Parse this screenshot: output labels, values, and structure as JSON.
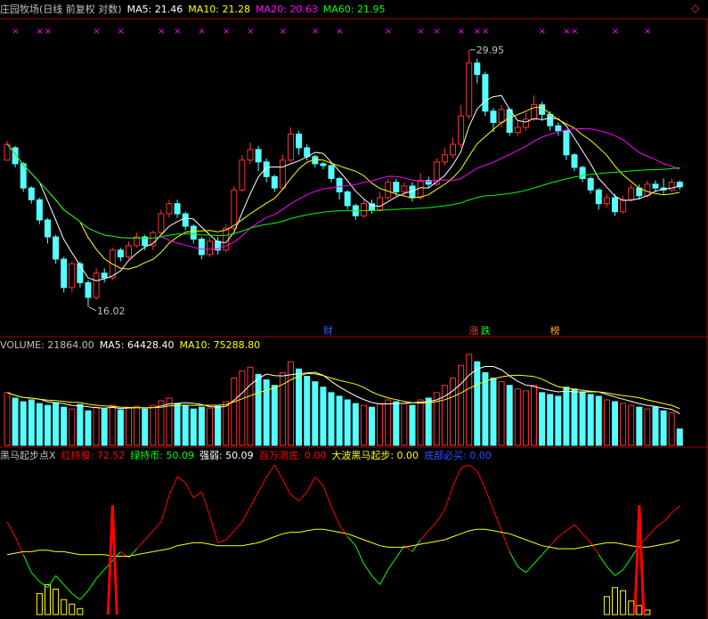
{
  "colors": {
    "bg": "#000000",
    "up": "#ff3232",
    "down": "#54ffff",
    "ma5": "#ffffff",
    "ma10": "#ffff00",
    "ma20": "#ff00ff",
    "ma60": "#00ff00",
    "grid": "#a00000",
    "marker": "#ff00ff",
    "label_gray": "#c0c0c0",
    "blue": "#0000ff",
    "green": "#00ff00",
    "red": "#ff0000",
    "yellow": "#ffff00"
  },
  "price_header": {
    "title": "庄园牧场(日线 前复权 对数)",
    "ma5": "MA5: 21.46",
    "ma10": "MA10: 21.28",
    "ma20": "MA20: 20.63",
    "ma60": "MA60: 21.95"
  },
  "volume_header": {
    "volume": "VOLUME: 21864.00",
    "ma5": "MA5: 64428.40",
    "ma10": "MA10: 75288.80"
  },
  "indicator_header": {
    "name": "黑马起步点X",
    "red_hold": "红持股: 72.52",
    "green_hold": "绿持币: 50.09",
    "strength": "强弱: 50.09",
    "million_bottom": "百万测底: 0.00",
    "wave_start": "大波黑马起步: 0.00",
    "bottom_buy": "底部必买: 0.00"
  },
  "annotations": {
    "high": "29.95",
    "low": "16.02",
    "tag_finance": "财",
    "tag_limit_up": "涨",
    "tag_limit_down": "跌",
    "tag_list": "榜"
  },
  "chart_data": [
    {
      "type": "candlestick",
      "title": "庄园牧场(日线 前复权 对数)",
      "scale": "log",
      "ylim": [
        15.5,
        31.0
      ],
      "annotated_high": 29.95,
      "annotated_low": 16.02,
      "series_ma": [
        {
          "name": "MA5",
          "last": 21.46
        },
        {
          "name": "MA10",
          "last": 21.28
        },
        {
          "name": "MA20",
          "last": 20.63
        },
        {
          "name": "MA60",
          "last": 21.95
        }
      ],
      "candles": [
        [
          22.9,
          23.8,
          23.6,
          24.0
        ],
        [
          23.6,
          22.7,
          22.5,
          23.7
        ],
        [
          22.7,
          21.4,
          21.2,
          22.8
        ],
        [
          21.4,
          20.8,
          20.6,
          21.5
        ],
        [
          20.8,
          19.8,
          19.6,
          20.9
        ],
        [
          19.8,
          19.0,
          18.7,
          19.9
        ],
        [
          19.0,
          18.0,
          17.8,
          19.1
        ],
        [
          18.0,
          16.8,
          16.6,
          18.1
        ],
        [
          16.8,
          17.8,
          16.6,
          17.9
        ],
        [
          17.8,
          17.0,
          16.8,
          17.9
        ],
        [
          17.0,
          16.4,
          16.02,
          17.1
        ],
        [
          16.4,
          17.4,
          16.3,
          17.6
        ],
        [
          17.4,
          17.2,
          17.0,
          17.6
        ],
        [
          17.2,
          18.4,
          17.1,
          18.5
        ],
        [
          18.4,
          18.1,
          17.9,
          18.5
        ],
        [
          18.1,
          18.6,
          18.0,
          18.8
        ],
        [
          18.6,
          19.0,
          18.5,
          19.2
        ],
        [
          19.0,
          18.6,
          18.4,
          19.1
        ],
        [
          18.6,
          19.2,
          18.4,
          19.3
        ],
        [
          19.2,
          20.1,
          19.1,
          20.3
        ],
        [
          20.1,
          20.6,
          19.9,
          20.8
        ],
        [
          20.6,
          20.1,
          19.9,
          20.8
        ],
        [
          20.1,
          19.5,
          19.3,
          20.2
        ],
        [
          19.5,
          18.9,
          18.7,
          19.6
        ],
        [
          18.9,
          18.2,
          18.0,
          19.0
        ],
        [
          18.2,
          18.8,
          18.1,
          19.0
        ],
        [
          18.8,
          18.4,
          18.2,
          19.0
        ],
        [
          18.4,
          19.4,
          18.3,
          19.6
        ],
        [
          19.4,
          21.3,
          19.3,
          21.5
        ],
        [
          21.3,
          22.9,
          21.2,
          23.2
        ],
        [
          22.9,
          23.5,
          22.7,
          23.9
        ],
        [
          23.5,
          22.8,
          22.3,
          23.7
        ],
        [
          22.8,
          22.0,
          21.7,
          23.0
        ],
        [
          22.0,
          21.4,
          21.2,
          22.1
        ],
        [
          21.4,
          22.9,
          21.3,
          23.2
        ],
        [
          22.9,
          24.4,
          22.8,
          24.8
        ],
        [
          24.4,
          23.6,
          23.2,
          24.6
        ],
        [
          23.6,
          23.1,
          22.9,
          23.8
        ],
        [
          23.1,
          22.7,
          22.5,
          23.2
        ],
        [
          22.7,
          22.6,
          22.4,
          22.8
        ],
        [
          22.6,
          21.9,
          21.7,
          22.7
        ],
        [
          21.9,
          21.2,
          20.8,
          22.0
        ],
        [
          21.2,
          20.5,
          20.3,
          21.3
        ],
        [
          20.5,
          20.0,
          19.8,
          20.6
        ],
        [
          20.0,
          20.6,
          19.9,
          20.8
        ],
        [
          20.6,
          20.3,
          20.1,
          20.8
        ],
        [
          20.3,
          20.9,
          20.2,
          21.2
        ],
        [
          20.9,
          21.7,
          20.8,
          21.9
        ],
        [
          21.7,
          21.2,
          21.0,
          21.9
        ],
        [
          21.2,
          21.5,
          21.0,
          21.7
        ],
        [
          21.5,
          20.9,
          20.7,
          21.7
        ],
        [
          20.9,
          21.8,
          20.8,
          22.2
        ],
        [
          21.8,
          21.6,
          21.4,
          22.0
        ],
        [
          21.6,
          22.8,
          21.5,
          23.0
        ],
        [
          22.8,
          23.2,
          22.6,
          23.6
        ],
        [
          23.2,
          23.8,
          23.0,
          24.2
        ],
        [
          23.8,
          25.5,
          23.6,
          26.2
        ],
        [
          25.5,
          29.0,
          25.3,
          29.95
        ],
        [
          29.0,
          28.2,
          27.6,
          29.3
        ],
        [
          28.2,
          25.8,
          25.5,
          28.4
        ],
        [
          25.8,
          25.1,
          24.5,
          26.0
        ],
        [
          25.1,
          25.9,
          24.8,
          26.2
        ],
        [
          25.9,
          24.5,
          24.3,
          26.0
        ],
        [
          24.5,
          24.8,
          24.3,
          25.2
        ],
        [
          24.8,
          25.3,
          24.6,
          25.7
        ],
        [
          25.3,
          26.2,
          25.2,
          26.8
        ],
        [
          26.2,
          25.6,
          25.2,
          26.4
        ],
        [
          25.6,
          24.9,
          24.6,
          25.8
        ],
        [
          24.9,
          24.6,
          24.3,
          25.1
        ],
        [
          24.6,
          23.2,
          22.9,
          24.7
        ],
        [
          23.2,
          22.5,
          22.3,
          23.3
        ],
        [
          22.5,
          21.9,
          21.7,
          22.6
        ],
        [
          21.9,
          21.3,
          21.1,
          22.0
        ],
        [
          21.3,
          20.6,
          20.3,
          21.4
        ],
        [
          20.6,
          20.9,
          20.4,
          21.1
        ],
        [
          20.9,
          20.2,
          20.0,
          21.1
        ],
        [
          20.2,
          20.8,
          20.1,
          21.0
        ],
        [
          20.8,
          21.4,
          20.7,
          21.6
        ],
        [
          21.4,
          21.0,
          20.8,
          21.6
        ],
        [
          21.0,
          21.6,
          20.9,
          21.8
        ],
        [
          21.6,
          21.4,
          21.2,
          21.8
        ],
        [
          21.4,
          21.3,
          21.1,
          21.9
        ],
        [
          21.3,
          21.7,
          21.2,
          21.9
        ],
        [
          21.7,
          21.46,
          21.3,
          21.8
        ]
      ]
    },
    {
      "type": "bar",
      "title": "VOLUME",
      "last": 21864.0,
      "ma5_last": 64428.4,
      "ma10_last": 75288.8,
      "values": [
        58,
        52,
        48,
        50,
        46,
        44,
        47,
        42,
        40,
        45,
        38,
        42,
        40,
        44,
        39,
        41,
        43,
        40,
        44,
        49,
        52,
        46,
        44,
        40,
        42,
        41,
        43,
        48,
        74,
        82,
        86,
        78,
        72,
        66,
        80,
        92,
        84,
        76,
        70,
        64,
        58,
        54,
        50,
        46,
        44,
        42,
        46,
        50,
        48,
        46,
        44,
        50,
        52,
        58,
        66,
        74,
        88,
        100,
        92,
        80,
        74,
        70,
        66,
        62,
        60,
        66,
        58,
        56,
        54,
        64,
        62,
        58,
        56,
        54,
        50,
        48,
        46,
        44,
        42,
        40,
        42,
        38,
        36,
        18
      ]
    },
    {
      "type": "line",
      "title": "黑马起步点X",
      "ylim": [
        0,
        100
      ],
      "series": [
        {
          "name": "红持股",
          "last": 72.52
        },
        {
          "name": "绿持币",
          "last": 50.09
        },
        {
          "name": "强弱",
          "last": 50.09
        },
        {
          "name": "百万测底",
          "last": 0.0
        },
        {
          "name": "大波黑马起步",
          "last": 0.0
        },
        {
          "name": "底部必买",
          "last": 0.0
        }
      ],
      "strength": [
        62,
        52,
        40,
        28,
        22,
        18,
        26,
        20,
        14,
        10,
        16,
        24,
        30,
        36,
        42,
        38,
        44,
        50,
        56,
        62,
        80,
        92,
        88,
        78,
        82,
        66,
        48,
        50,
        56,
        62,
        72,
        82,
        92,
        100,
        90,
        80,
        76,
        82,
        92,
        86,
        72,
        60,
        52,
        46,
        34,
        26,
        20,
        30,
        38,
        46,
        42,
        50,
        56,
        62,
        70,
        86,
        98,
        100,
        96,
        84,
        70,
        56,
        42,
        32,
        28,
        34,
        40,
        46,
        52,
        56,
        60,
        54,
        48,
        40,
        32,
        26,
        30,
        38,
        46,
        52,
        58,
        62,
        68,
        72.52
      ],
      "reference": [
        40,
        41,
        42,
        42,
        43,
        43,
        42,
        42,
        41,
        40,
        40,
        40,
        40,
        39,
        39,
        39,
        40,
        41,
        42,
        43,
        44,
        46,
        47,
        48,
        48,
        47,
        46,
        46,
        46,
        46,
        47,
        48,
        50,
        52,
        54,
        55,
        55,
        56,
        57,
        57,
        56,
        55,
        54,
        52,
        50,
        48,
        46,
        45,
        45,
        45,
        46,
        47,
        48,
        49,
        50,
        52,
        54,
        56,
        57,
        57,
        56,
        55,
        54,
        52,
        50,
        48,
        46,
        45,
        44,
        44,
        44,
        45,
        46,
        47,
        48,
        48,
        47,
        46,
        45,
        45,
        46,
        47,
        48,
        50.09
      ],
      "spikes_red": [
        13,
        78
      ],
      "bottom_bars": [
        [
          4,
          14
        ],
        [
          5,
          20
        ],
        [
          6,
          17
        ],
        [
          7,
          10
        ],
        [
          8,
          7
        ],
        [
          9,
          4
        ],
        [
          74,
          12
        ],
        [
          75,
          18
        ],
        [
          76,
          16
        ],
        [
          77,
          9
        ],
        [
          78,
          6
        ],
        [
          79,
          3
        ]
      ]
    }
  ],
  "markers_top": [
    1,
    4,
    5,
    11,
    14,
    19,
    21,
    24,
    27,
    30,
    34,
    38,
    41,
    47,
    51,
    53,
    56,
    58,
    59,
    66,
    69,
    70,
    75,
    79
  ]
}
